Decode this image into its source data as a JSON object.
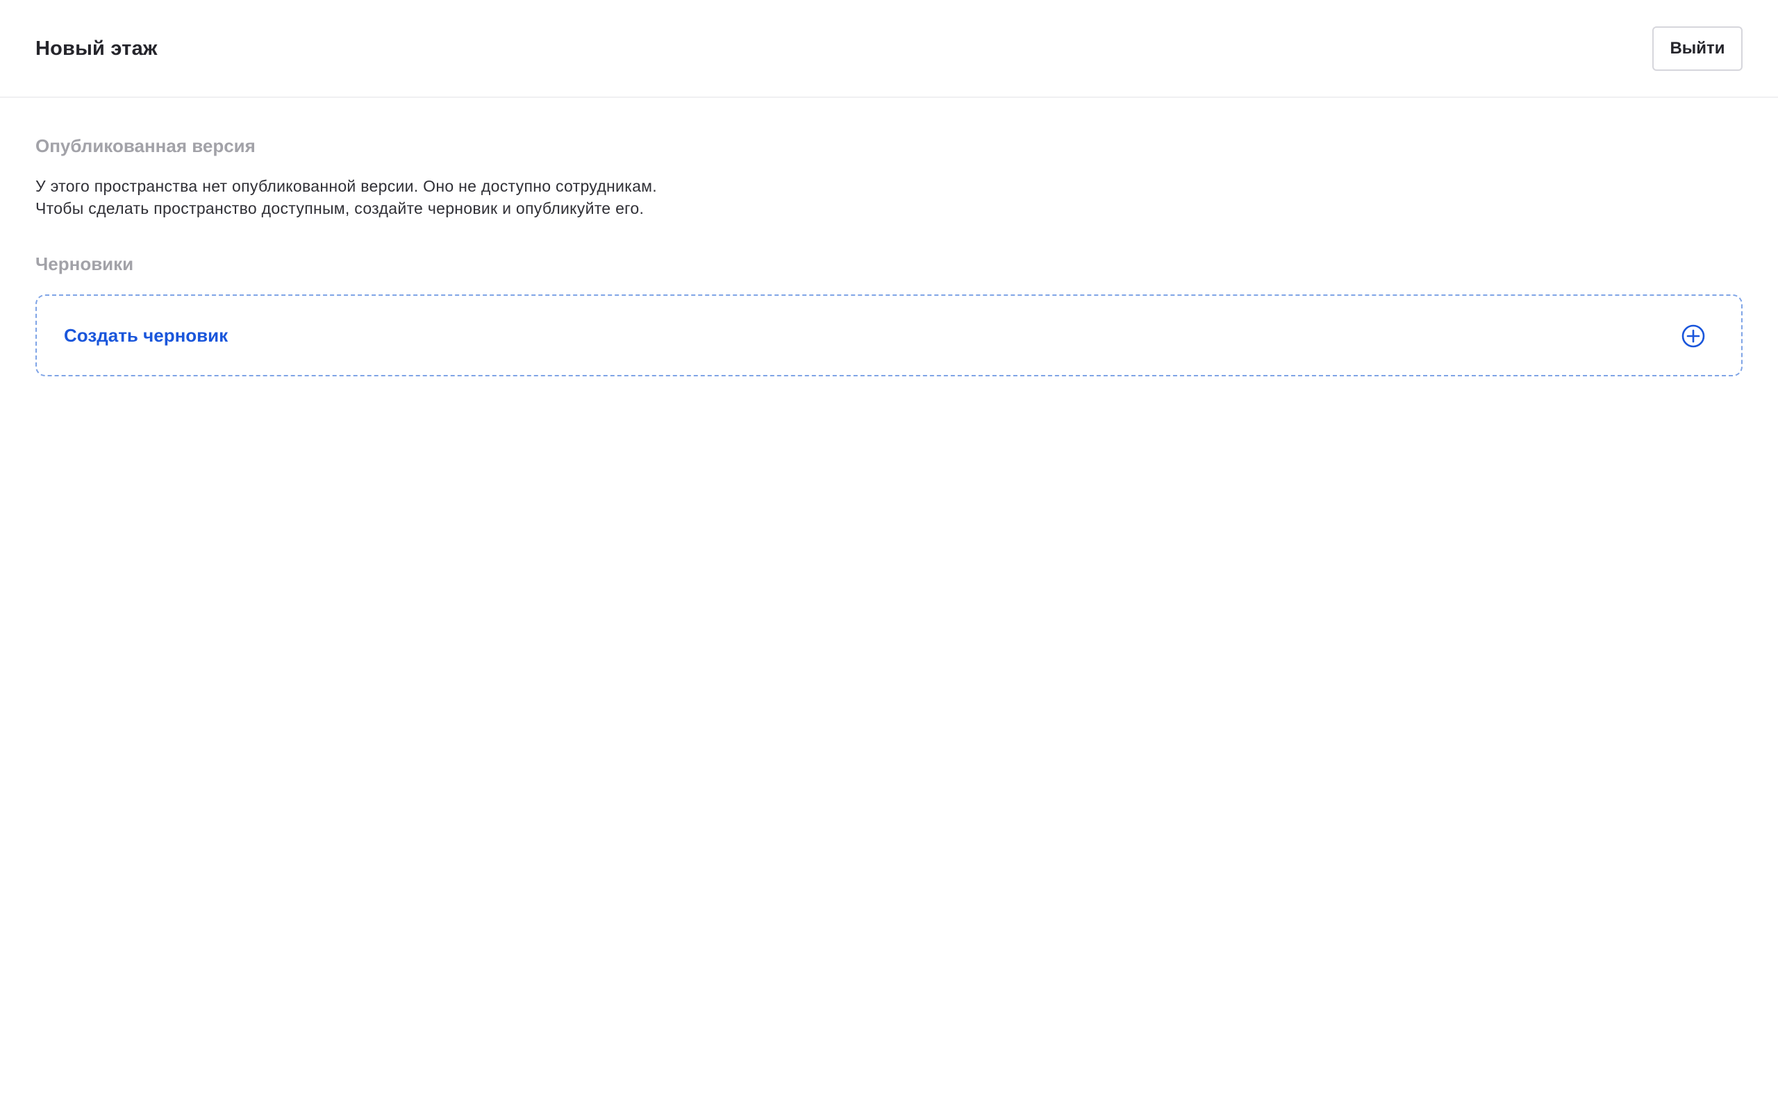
{
  "header": {
    "title": "Новый этаж",
    "exit_label": "Выйти"
  },
  "published": {
    "title": "Опубликованная версия",
    "description_line1": "У этого пространства нет опубликованной версии. Оно не доступно сотрудникам.",
    "description_line2": "Чтобы сделать пространство доступным, создайте черновик и опубликуйте его."
  },
  "drafts": {
    "title": "Черновики",
    "create_label": "Создать черновик",
    "create_icon": "plus-circle-icon"
  },
  "colors": {
    "accent": "#1a56db",
    "section_title": "#a2a2a8",
    "dashed_border": "#7fa4e6"
  }
}
